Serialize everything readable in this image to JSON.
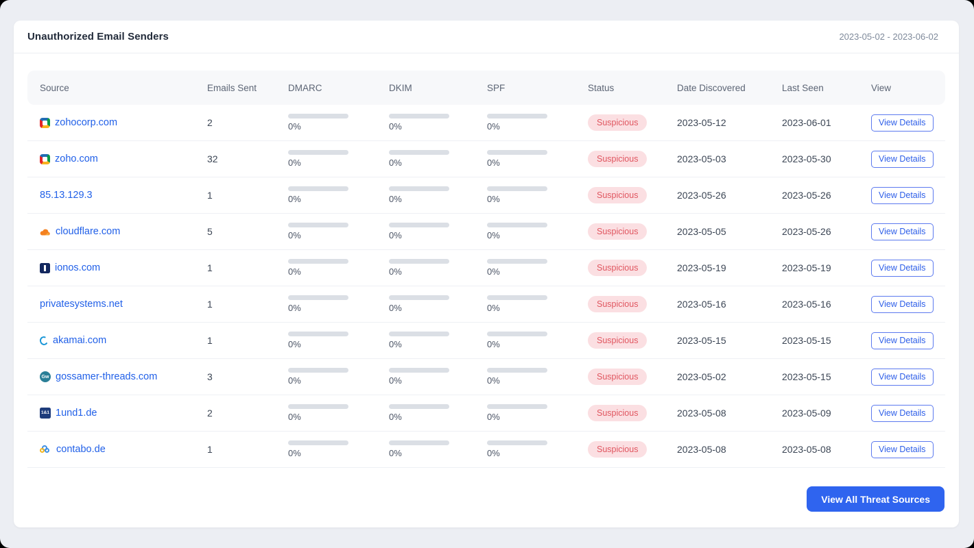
{
  "header": {
    "title": "Unauthorized Email Senders",
    "date_range": "2023-05-02 - 2023-06-02"
  },
  "table": {
    "columns": [
      "Source",
      "Emails Sent",
      "DMARC",
      "DKIM",
      "SPF",
      "Status",
      "Date Discovered",
      "Last Seen",
      "View"
    ],
    "view_details_label": "View Details",
    "rows": [
      {
        "source": "zohocorp.com",
        "icon": "zoho",
        "icon_text": "",
        "emails_sent": "2",
        "dmarc": "0%",
        "dkim": "0%",
        "spf": "0%",
        "status": "Suspicious",
        "date_discovered": "2023-05-12",
        "last_seen": "2023-06-01"
      },
      {
        "source": "zoho.com",
        "icon": "zoho",
        "icon_text": "",
        "emails_sent": "32",
        "dmarc": "0%",
        "dkim": "0%",
        "spf": "0%",
        "status": "Suspicious",
        "date_discovered": "2023-05-03",
        "last_seen": "2023-05-30"
      },
      {
        "source": "85.13.129.3",
        "icon": "",
        "icon_text": "",
        "emails_sent": "1",
        "dmarc": "0%",
        "dkim": "0%",
        "spf": "0%",
        "status": "Suspicious",
        "date_discovered": "2023-05-26",
        "last_seen": "2023-05-26"
      },
      {
        "source": "cloudflare.com",
        "icon": "cloudflare",
        "icon_text": "",
        "emails_sent": "5",
        "dmarc": "0%",
        "dkim": "0%",
        "spf": "0%",
        "status": "Suspicious",
        "date_discovered": "2023-05-05",
        "last_seen": "2023-05-26"
      },
      {
        "source": "ionos.com",
        "icon": "ionos",
        "icon_text": "",
        "emails_sent": "1",
        "dmarc": "0%",
        "dkim": "0%",
        "spf": "0%",
        "status": "Suspicious",
        "date_discovered": "2023-05-19",
        "last_seen": "2023-05-19"
      },
      {
        "source": "privatesystems.net",
        "icon": "",
        "icon_text": "",
        "emails_sent": "1",
        "dmarc": "0%",
        "dkim": "0%",
        "spf": "0%",
        "status": "Suspicious",
        "date_discovered": "2023-05-16",
        "last_seen": "2023-05-16"
      },
      {
        "source": "akamai.com",
        "icon": "akamai",
        "icon_text": "",
        "emails_sent": "1",
        "dmarc": "0%",
        "dkim": "0%",
        "spf": "0%",
        "status": "Suspicious",
        "date_discovered": "2023-05-15",
        "last_seen": "2023-05-15"
      },
      {
        "source": "gossamer-threads.com",
        "icon": "gossamer",
        "icon_text": "Gw",
        "emails_sent": "3",
        "dmarc": "0%",
        "dkim": "0%",
        "spf": "0%",
        "status": "Suspicious",
        "date_discovered": "2023-05-02",
        "last_seen": "2023-05-15"
      },
      {
        "source": "1und1.de",
        "icon": "1und1",
        "icon_text": "1&1",
        "emails_sent": "2",
        "dmarc": "0%",
        "dkim": "0%",
        "spf": "0%",
        "status": "Suspicious",
        "date_discovered": "2023-05-08",
        "last_seen": "2023-05-09"
      },
      {
        "source": "contabo.de",
        "icon": "contabo",
        "icon_text": "",
        "emails_sent": "1",
        "dmarc": "0%",
        "dkim": "0%",
        "spf": "0%",
        "status": "Suspicious",
        "date_discovered": "2023-05-08",
        "last_seen": "2023-05-08"
      }
    ]
  },
  "footer": {
    "view_all_label": "View All Threat Sources"
  },
  "colors": {
    "page_background": "#eceef3",
    "card_background": "#ffffff",
    "accent_blue": "#2f64ef",
    "link_blue": "#2160e8",
    "badge_background": "#fbdfe2",
    "badge_text": "#e0555f",
    "progress_track": "#dbdfe5"
  }
}
